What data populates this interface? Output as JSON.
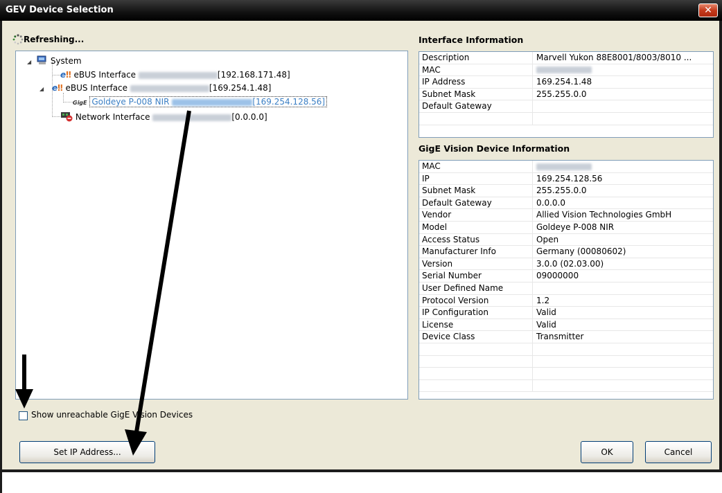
{
  "window": {
    "title": "GEV Device Selection",
    "close_label": "✕"
  },
  "status": {
    "text": "Refreshing..."
  },
  "tree": {
    "system": "System",
    "nodes": [
      {
        "label": "eBUS Interface",
        "address": "[192.168.171.48]"
      },
      {
        "label": "eBUS Interface",
        "address": "[169.254.1.48]"
      },
      {
        "label": "Goldeye P-008 NIR",
        "address": "[169.254.128.56]"
      },
      {
        "label": "Network Interface",
        "address": "[0.0.0.0]"
      }
    ]
  },
  "interface_info": {
    "title": "Interface Information",
    "rows": [
      {
        "key": "Description",
        "value": "Marvell Yukon 88E8001/8003/8010 ..."
      },
      {
        "key": "MAC",
        "value": ""
      },
      {
        "key": "IP Address",
        "value": "169.254.1.48"
      },
      {
        "key": "Subnet Mask",
        "value": "255.255.0.0"
      },
      {
        "key": "Default Gateway",
        "value": ""
      },
      {
        "key": "",
        "value": ""
      }
    ]
  },
  "device_info": {
    "title": "GigE Vision Device Information",
    "rows": [
      {
        "key": "MAC",
        "value": ""
      },
      {
        "key": "IP",
        "value": "169.254.128.56"
      },
      {
        "key": "Subnet Mask",
        "value": "255.255.0.0"
      },
      {
        "key": "Default Gateway",
        "value": "0.0.0.0"
      },
      {
        "key": "Vendor",
        "value": "Allied Vision Technologies GmbH"
      },
      {
        "key": "Model",
        "value": "Goldeye P-008 NIR"
      },
      {
        "key": "Access Status",
        "value": "Open"
      },
      {
        "key": "Manufacturer Info",
        "value": "Germany  (00080602)"
      },
      {
        "key": "Version",
        "value": "3.0.0  (02.03.00)"
      },
      {
        "key": "Serial Number",
        "value": "09000000"
      },
      {
        "key": "User Defined Name",
        "value": ""
      },
      {
        "key": "Protocol Version",
        "value": "1.2"
      },
      {
        "key": "IP Configuration",
        "value": "Valid"
      },
      {
        "key": "License",
        "value": "Valid"
      },
      {
        "key": "Device Class",
        "value": "Transmitter"
      },
      {
        "key": "",
        "value": ""
      },
      {
        "key": "",
        "value": ""
      },
      {
        "key": "",
        "value": ""
      },
      {
        "key": "",
        "value": ""
      }
    ]
  },
  "options": {
    "show_unreachable_label": "Show unreachable GigE Vision Devices",
    "show_unreachable_checked": false
  },
  "buttons": {
    "set_ip": "Set IP Address...",
    "ok": "OK",
    "cancel": "Cancel"
  }
}
